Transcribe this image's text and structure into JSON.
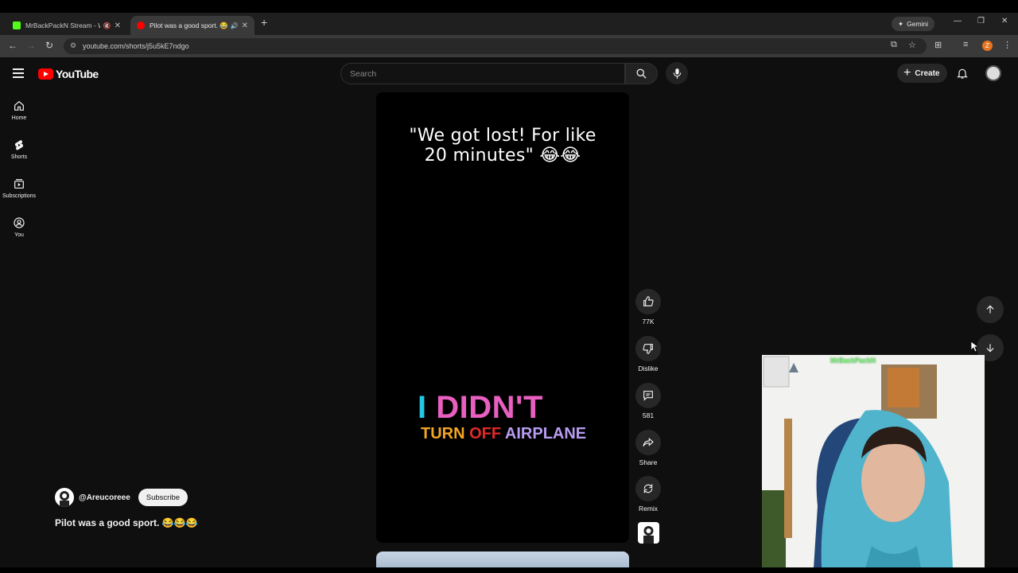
{
  "browser": {
    "tabs": [
      {
        "title": "MrBackPackN Stream - Wat",
        "active": false
      },
      {
        "title": "Pilot was a good sport. 😂😂",
        "active": true
      }
    ],
    "gemini_label": "Gemini",
    "url": "youtube.com/shorts/j5u5kE7ndgo"
  },
  "header": {
    "logo_text": "YouTube",
    "search_placeholder": "Search",
    "create_label": "Create"
  },
  "sidebar": {
    "items": [
      {
        "label": "Home",
        "icon": "home-icon"
      },
      {
        "label": "Shorts",
        "icon": "shorts-icon"
      },
      {
        "label": "Subscriptions",
        "icon": "subscriptions-icon"
      },
      {
        "label": "You",
        "icon": "you-icon"
      }
    ]
  },
  "short": {
    "caption_line1": "\"We got lost! For like",
    "caption_line2": "20 minutes\" 😂😂",
    "overlay_i": "I ",
    "overlay_didnt": "DIDN'T",
    "overlay_turn": "TURN ",
    "overlay_off": "OFF ",
    "overlay_airplane": "AIRPLANE",
    "channel": "@Areucoreee",
    "subscribe_label": "Subscribe",
    "title": "Pilot was a good sport. 😂😂😂"
  },
  "actions": {
    "likes": "77K",
    "dislike_label": "Dislike",
    "comments": "581",
    "share_label": "Share",
    "remix_label": "Remix"
  },
  "overlay": {
    "streamer_tag": "MrBackPackN"
  },
  "colors": {
    "youtube_red": "#ff0000",
    "overlay_cyan": "#22c8e6",
    "overlay_pink": "#e85fbf",
    "overlay_orange": "#f5a623",
    "overlay_red": "#e02a2a",
    "overlay_lavender": "#b89cf0"
  }
}
